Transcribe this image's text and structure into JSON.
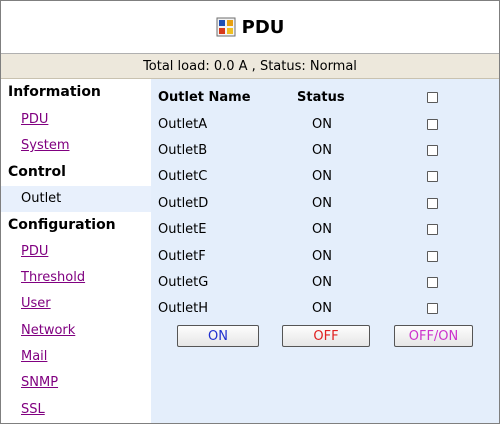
{
  "header": {
    "title": "PDU",
    "logo_icon": "pdu-logo-icon"
  },
  "status_line": "Total load: 0.0 A , Status: Normal",
  "sidebar": {
    "sections": [
      {
        "heading": "Information",
        "items": [
          "PDU",
          "System"
        ]
      },
      {
        "heading": "Control",
        "items": [
          "Outlet"
        ],
        "active": "Outlet"
      },
      {
        "heading": "Configuration",
        "items": [
          "PDU",
          "Threshold",
          "User",
          "Network",
          "Mail",
          "SNMP",
          "SSL"
        ]
      }
    ]
  },
  "table": {
    "headers": {
      "name": "Outlet Name",
      "status": "Status"
    },
    "rows": [
      {
        "name": "OutletA",
        "status": "ON",
        "checked": false
      },
      {
        "name": "OutletB",
        "status": "ON",
        "checked": false
      },
      {
        "name": "OutletC",
        "status": "ON",
        "checked": false
      },
      {
        "name": "OutletD",
        "status": "ON",
        "checked": false
      },
      {
        "name": "OutletE",
        "status": "ON",
        "checked": false
      },
      {
        "name": "OutletF",
        "status": "ON",
        "checked": false
      },
      {
        "name": "OutletG",
        "status": "ON",
        "checked": false
      },
      {
        "name": "OutletH",
        "status": "ON",
        "checked": false
      }
    ]
  },
  "buttons": {
    "on": {
      "label": "ON",
      "color": "#1f2fd0"
    },
    "off": {
      "label": "OFF",
      "color": "#e02020"
    },
    "offon": {
      "label": "OFF/ON",
      "color": "#cc33cc"
    }
  }
}
